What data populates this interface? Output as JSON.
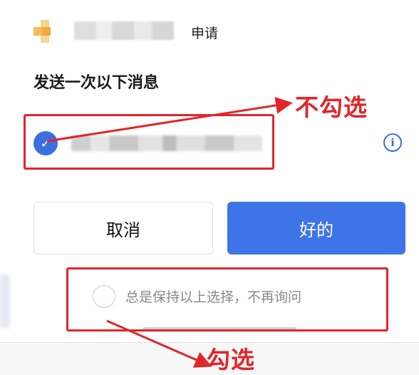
{
  "dialog": {
    "apply_label": "申请",
    "heading": "发送一次以下消息",
    "cancel_label": "取消",
    "ok_label": "好的",
    "always_label": "总是保持以上选择，不再询问"
  },
  "annotations": {
    "uncheck_note": "不勾选",
    "check_note": "勾选"
  },
  "icons": {
    "check": "checkmark-icon",
    "info": "info-icon"
  },
  "colors": {
    "accent": "#3f74e6",
    "annotation_red": "#e0262a"
  }
}
